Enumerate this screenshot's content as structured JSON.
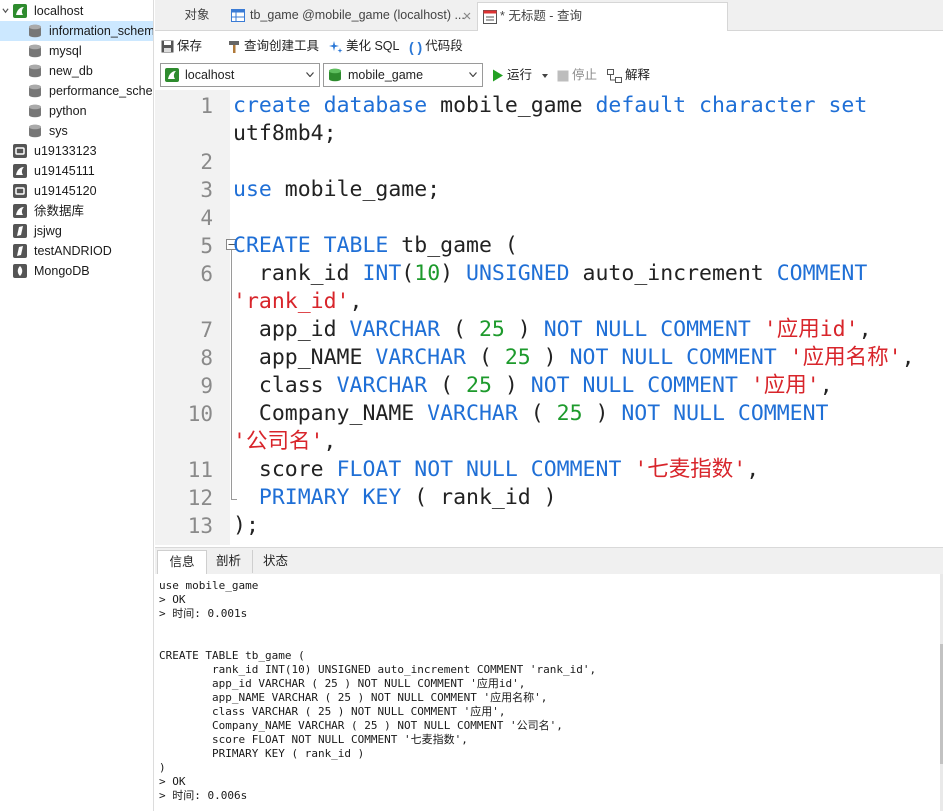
{
  "sidebar": {
    "connection": "localhost",
    "databases": [
      "information_schema",
      "mysql",
      "new_db",
      "performance_schema",
      "python",
      "sys"
    ],
    "other_connections": [
      {
        "label": "u19133123",
        "icon": "mariadb-icon"
      },
      {
        "label": "u19145111",
        "icon": "mysql-connection-icon"
      },
      {
        "label": "u19145120",
        "icon": "mariadb-icon"
      },
      {
        "label": "徐数据库",
        "icon": "mysql-connection-icon"
      },
      {
        "label": "jsjwg",
        "icon": "sqlite-icon"
      },
      {
        "label": "testANDRIOD",
        "icon": "sqlite-icon"
      },
      {
        "label": "MongoDB",
        "icon": "mongodb-icon"
      }
    ]
  },
  "tabs": {
    "objects": "对象",
    "table_tab": "tb_game @mobile_game (localhost) ...",
    "query_tab": "* 无标题 - 查询"
  },
  "toolbar": {
    "save": "保存",
    "query_builder": "查询创建工具",
    "beautify": "美化 SQL",
    "snippet": "代码段",
    "connection_value": "localhost",
    "database_value": "mobile_game",
    "run": "运行",
    "stop": "停止",
    "explain": "解释"
  },
  "editor": {
    "line_numbers": [
      "1",
      "2",
      "3",
      "4",
      "5",
      "6",
      "7",
      "8",
      "9",
      "10",
      "11",
      "12",
      "13"
    ]
  },
  "result": {
    "tabs": [
      "信息",
      "剖析",
      "状态"
    ],
    "lines": [
      "use mobile_game",
      "> OK",
      "> 时间: 0.001s",
      "",
      "",
      "CREATE TABLE tb_game (",
      "        rank_id INT(10) UNSIGNED auto_increment COMMENT 'rank_id',",
      "        app_id VARCHAR ( 25 ) NOT NULL COMMENT '应用id',",
      "        app_NAME VARCHAR ( 25 ) NOT NULL COMMENT '应用名称',",
      "        class VARCHAR ( 25 ) NOT NULL COMMENT '应用',",
      "        Company_NAME VARCHAR ( 25 ) NOT NULL COMMENT '公司名',",
      "        score FLOAT NOT NULL COMMENT '七麦指数',",
      "        PRIMARY KEY ( rank_id )",
      ")",
      "> OK",
      "> 时间: 0.006s"
    ]
  }
}
